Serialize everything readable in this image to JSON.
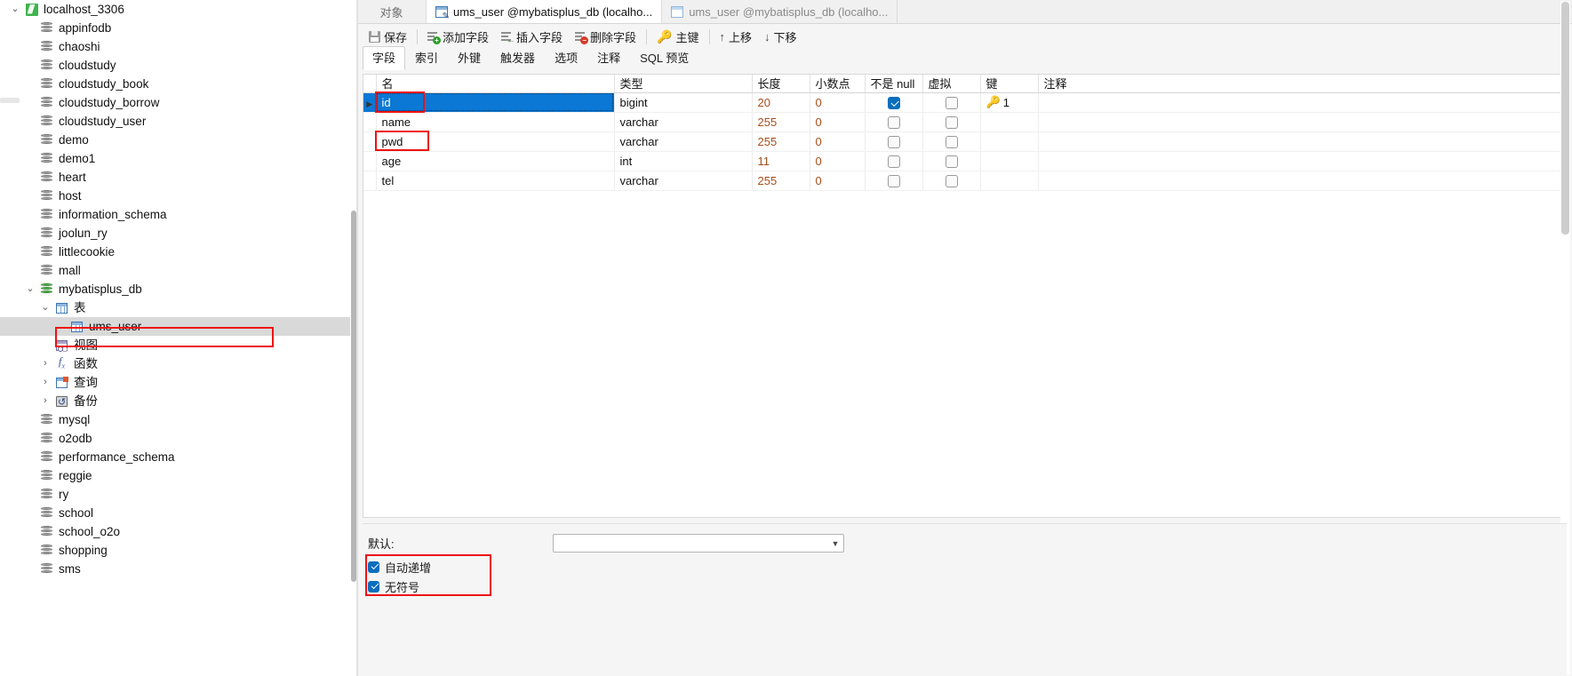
{
  "sidebar": {
    "tree": [
      {
        "label": "localhost_3306",
        "icon": "connection-icon",
        "indent": 0,
        "twisty": "⌄",
        "expanded": true
      },
      {
        "label": "appinfodb",
        "icon": "database-icon",
        "indent": 1,
        "twisty": ""
      },
      {
        "label": "chaoshi",
        "icon": "database-icon",
        "indent": 1,
        "twisty": ""
      },
      {
        "label": "cloudstudy",
        "icon": "database-icon",
        "indent": 1,
        "twisty": ""
      },
      {
        "label": "cloudstudy_book",
        "icon": "database-icon",
        "indent": 1,
        "twisty": ""
      },
      {
        "label": "cloudstudy_borrow",
        "icon": "database-icon",
        "indent": 1,
        "twisty": ""
      },
      {
        "label": "cloudstudy_user",
        "icon": "database-icon",
        "indent": 1,
        "twisty": ""
      },
      {
        "label": "demo",
        "icon": "database-icon",
        "indent": 1,
        "twisty": ""
      },
      {
        "label": "demo1",
        "icon": "database-icon",
        "indent": 1,
        "twisty": ""
      },
      {
        "label": "heart",
        "icon": "database-icon",
        "indent": 1,
        "twisty": ""
      },
      {
        "label": "host",
        "icon": "database-icon",
        "indent": 1,
        "twisty": ""
      },
      {
        "label": "information_schema",
        "icon": "database-icon",
        "indent": 1,
        "twisty": ""
      },
      {
        "label": "joolun_ry",
        "icon": "database-icon",
        "indent": 1,
        "twisty": ""
      },
      {
        "label": "littlecookie",
        "icon": "database-icon",
        "indent": 1,
        "twisty": ""
      },
      {
        "label": "mall",
        "icon": "database-icon",
        "indent": 1,
        "twisty": ""
      },
      {
        "label": "mybatisplus_db",
        "icon": "database-open-icon",
        "indent": 1,
        "twisty": "⌄",
        "expanded": true
      },
      {
        "label": "表",
        "icon": "table-folder-icon",
        "indent": 2,
        "twisty": "⌄",
        "expanded": true
      },
      {
        "label": "ums_user",
        "icon": "table-icon",
        "indent": 3,
        "twisty": "",
        "selected": true
      },
      {
        "label": "视图",
        "icon": "view-icon",
        "indent": 2,
        "twisty": ""
      },
      {
        "label": "函数",
        "icon": "function-icon",
        "indent": 2,
        "twisty": "›"
      },
      {
        "label": "查询",
        "icon": "query-icon",
        "indent": 2,
        "twisty": "›"
      },
      {
        "label": "备份",
        "icon": "backup-icon",
        "indent": 2,
        "twisty": "›"
      },
      {
        "label": "mysql",
        "icon": "database-icon",
        "indent": 1,
        "twisty": ""
      },
      {
        "label": "o2odb",
        "icon": "database-icon",
        "indent": 1,
        "twisty": ""
      },
      {
        "label": "performance_schema",
        "icon": "database-icon",
        "indent": 1,
        "twisty": ""
      },
      {
        "label": "reggie",
        "icon": "database-icon",
        "indent": 1,
        "twisty": ""
      },
      {
        "label": "ry",
        "icon": "database-icon",
        "indent": 1,
        "twisty": ""
      },
      {
        "label": "school",
        "icon": "database-icon",
        "indent": 1,
        "twisty": ""
      },
      {
        "label": "school_o2o",
        "icon": "database-icon",
        "indent": 1,
        "twisty": ""
      },
      {
        "label": "shopping",
        "icon": "database-icon",
        "indent": 1,
        "twisty": ""
      },
      {
        "label": "sms",
        "icon": "database-icon",
        "indent": 1,
        "twisty": ""
      }
    ]
  },
  "tabbar": {
    "object_label": "对象",
    "tabs": [
      {
        "label": "ums_user @mybatisplus_db (localho...",
        "icon": "table-design-icon",
        "active": true
      },
      {
        "label": "ums_user @mybatisplus_db (localho...",
        "icon": "table-data-icon",
        "active": false
      }
    ]
  },
  "toolbar": {
    "buttons": [
      {
        "label": "保存",
        "icon": "save-icon"
      },
      {
        "label": "添加字段",
        "icon": "add-field-icon"
      },
      {
        "label": "插入字段",
        "icon": "insert-field-icon"
      },
      {
        "label": "删除字段",
        "icon": "delete-field-icon"
      },
      {
        "label": "主键",
        "icon": "key-icon"
      },
      {
        "label": "上移",
        "icon": "arrow-up-icon"
      },
      {
        "label": "下移",
        "icon": "arrow-down-icon"
      }
    ]
  },
  "subtabs": [
    {
      "label": "字段",
      "active": true
    },
    {
      "label": "索引",
      "active": false
    },
    {
      "label": "外键",
      "active": false
    },
    {
      "label": "触发器",
      "active": false
    },
    {
      "label": "选项",
      "active": false
    },
    {
      "label": "注释",
      "active": false
    },
    {
      "label": "SQL 预览",
      "active": false
    }
  ],
  "grid": {
    "columns": [
      "名",
      "类型",
      "长度",
      "小数点",
      "不是 null",
      "虚拟",
      "键",
      "注释"
    ],
    "rows": [
      {
        "name": "id",
        "type": "bigint",
        "length": "20",
        "decimals": "0",
        "not_null": true,
        "virtual": false,
        "key": "1",
        "key_icon": "primary-key-icon",
        "comment": "",
        "selected": true
      },
      {
        "name": "name",
        "type": "varchar",
        "length": "255",
        "decimals": "0",
        "not_null": false,
        "virtual": false,
        "key": "",
        "key_icon": "",
        "comment": "",
        "selected": false
      },
      {
        "name": "pwd",
        "type": "varchar",
        "length": "255",
        "decimals": "0",
        "not_null": false,
        "virtual": false,
        "key": "",
        "key_icon": "",
        "comment": "",
        "selected": false
      },
      {
        "name": "age",
        "type": "int",
        "length": "11",
        "decimals": "0",
        "not_null": false,
        "virtual": false,
        "key": "",
        "key_icon": "",
        "comment": "",
        "selected": false
      },
      {
        "name": "tel",
        "type": "varchar",
        "length": "255",
        "decimals": "0",
        "not_null": false,
        "virtual": false,
        "key": "",
        "key_icon": "",
        "comment": "",
        "selected": false
      }
    ]
  },
  "bottom": {
    "default_label": "默认:",
    "default_value": "",
    "auto_increment_label": "自动递增",
    "auto_increment_checked": true,
    "unsigned_label": "无符号",
    "unsigned_checked": true
  },
  "colors": {
    "selection_blue": "#0a78d4",
    "highlight_red": "#ee1111",
    "key_gold": "#e8a70c",
    "checkbox_blue": "#0a6ebd"
  }
}
